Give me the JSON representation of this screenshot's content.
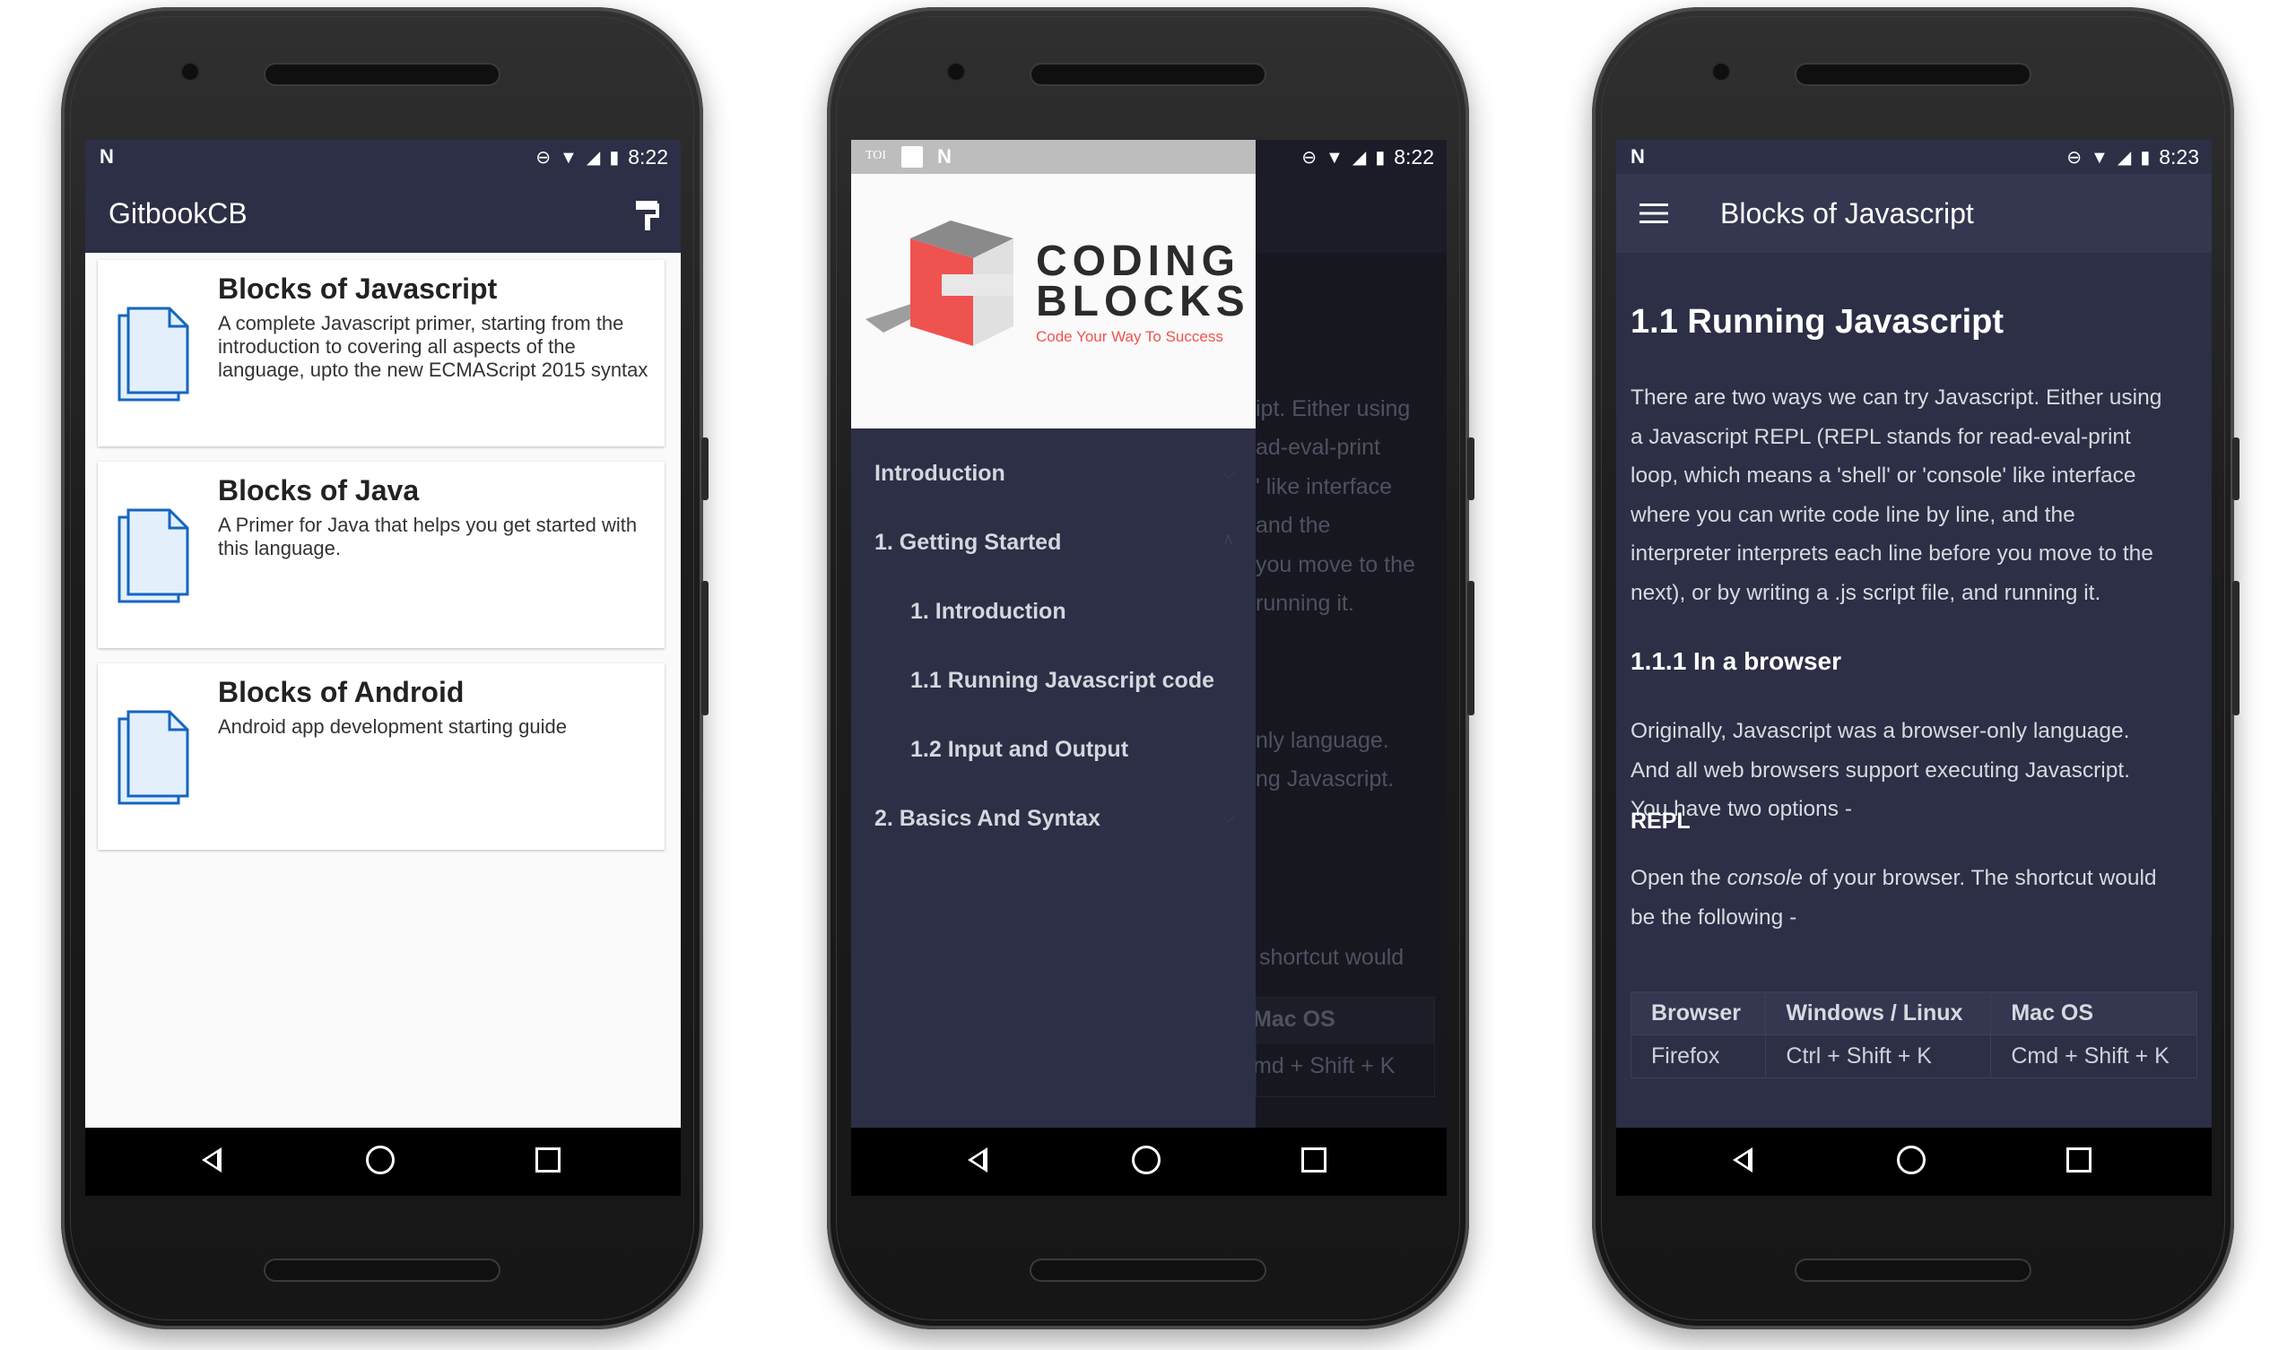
{
  "phone1": {
    "status_time": "8:22",
    "app_title": "GitbookCB",
    "cards": [
      {
        "title": "Blocks of Javascript",
        "description": "A complete Javascript primer, starting from the introduction to covering all aspects of the language, upto the new ECMAScript 2015 syntax"
      },
      {
        "title": "Blocks of Java",
        "description": "A Primer for Java that helps you get started with this language."
      },
      {
        "title": "Blocks of Android",
        "description": "Android app development starting guide"
      }
    ]
  },
  "phone2": {
    "status_time": "8:22",
    "status_left": "TOI",
    "logo_line1": "CODING",
    "logo_line2": "BLOCKS",
    "logo_tagline": "Code Your Way To Success",
    "toc": [
      {
        "label": "Introduction"
      },
      {
        "label": "1. Getting Started"
      },
      {
        "label": "1. Introduction"
      },
      {
        "label": "1.1 Running Javascript code"
      },
      {
        "label": "1.2 Input and Output"
      },
      {
        "label": "2. Basics And Syntax"
      }
    ],
    "behind_text": {
      "l1": "ipt. Either using",
      "l2": "ad-eval-print",
      "l3": "' like interface",
      "l4": "and the",
      "l5": "you move to the",
      "l6": "running it.",
      "l7": "nly language.",
      "l8": "ng Javascript.",
      "l9": "shortcut would",
      "l10": "Mac OS",
      "l11": "md + Shift + K"
    }
  },
  "phone3": {
    "status_time": "8:23",
    "app_title": "Blocks of Javascript",
    "heading": "1.1 Running Javascript",
    "para1_lines": [
      "There are two ways we can try Javascript. Either using",
      "a Javascript REPL (REPL stands for read-eval-print",
      "loop, which means a 'shell' or 'console' like interface",
      "where you can write code line by line, and the",
      "interpreter interprets each line before you move to the",
      "next), or by writing a .js script file, and running it."
    ],
    "subheading": "1.1.1 In a browser",
    "para2_lines": [
      "Originally, Javascript was a browser-only language.",
      "And all web browsers support executing Javascript.",
      "You have two options -"
    ],
    "repl_heading": "REPL",
    "para3_before": "Open the ",
    "para3_em": "console",
    "para3_after": " of your browser. The shortcut would",
    "para3_line2": "be the following -",
    "table": {
      "headers": [
        "Browser",
        "Windows / Linux",
        "Mac OS"
      ],
      "rows": [
        [
          "Firefox",
          "Ctrl + Shift + K",
          "Cmd + Shift + K"
        ]
      ]
    }
  }
}
